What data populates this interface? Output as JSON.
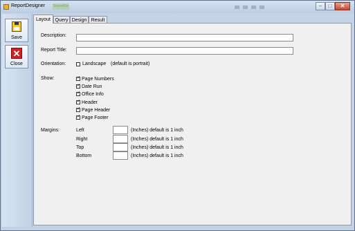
{
  "window": {
    "title": "ReportDesigner",
    "faded_tab": "ReportDe"
  },
  "toolbar": {
    "save_label": "Save",
    "close_label": "Close"
  },
  "tabs": [
    {
      "label": "Layout",
      "active": true
    },
    {
      "label": "Query",
      "active": false
    },
    {
      "label": "Design",
      "active": false
    },
    {
      "label": "Result",
      "active": false
    }
  ],
  "fields": {
    "description_label": "Description:",
    "description_value": "",
    "report_title_label": "Report Title:",
    "report_title_value": "",
    "orientation_label": "Orientation:",
    "landscape_label": "Landscape",
    "landscape_checked": false,
    "orientation_note": "(default is portrait)"
  },
  "show": {
    "label": "Show:",
    "items": [
      {
        "label": "Page Numbers",
        "checked": true
      },
      {
        "label": "Date Run",
        "checked": true
      },
      {
        "label": "Office Info",
        "checked": true
      },
      {
        "label": "Header",
        "checked": true
      },
      {
        "label": "Page Header",
        "checked": true
      },
      {
        "label": "Page Footer",
        "checked": true
      }
    ]
  },
  "margins": {
    "label": "Margins:",
    "items": [
      {
        "label": "Left",
        "value": "",
        "note": "(Inches) default is 1 inch"
      },
      {
        "label": "Right",
        "value": "",
        "note": "(Inches) default is 1 inch"
      },
      {
        "label": "Top",
        "value": "",
        "note": "(Inches) default is 1 inch"
      },
      {
        "label": "Bottom",
        "value": "",
        "note": "(Inches) default is 1 inch"
      }
    ]
  },
  "colors": {
    "window_frame": "#c5d3e4",
    "panel": "#f0f0f0",
    "close_button": "#c34a33",
    "close_icon": "#d02020"
  }
}
